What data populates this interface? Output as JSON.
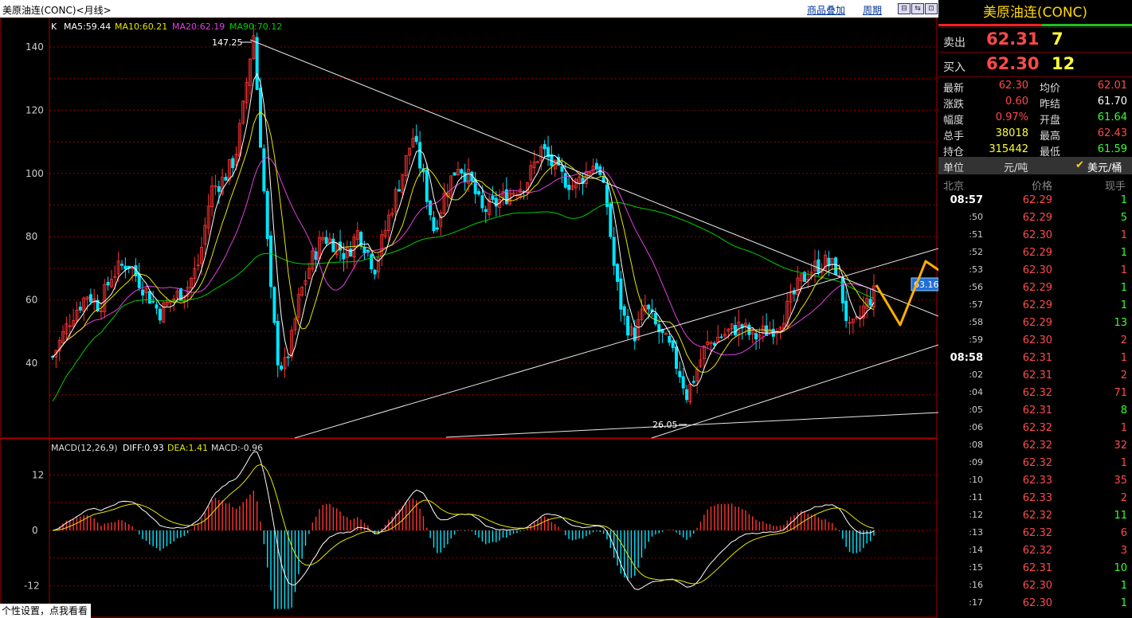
{
  "header": {
    "title": "美原油连(CONC)<月线>",
    "overlay_link": "商品叠加",
    "period_link": "周期",
    "win_buttons": [
      "⊟",
      "⇆",
      "⊡"
    ]
  },
  "indicators": {
    "main_type": "K",
    "ma5": "MA5:59.44",
    "ma10": "MA10:60.21",
    "ma20": "MA20:62.19",
    "ma90": "MA90:70.12",
    "macd_label": "MACD(12,26,9)",
    "diff": "DIFF:0.93",
    "dea": "DEA:1.41",
    "macd": "MACD:-0.96"
  },
  "chart_data": {
    "type": "candlestick",
    "main_axis": {
      "ticks": [
        "140",
        "120",
        "100",
        "80",
        "60",
        "40"
      ],
      "range": [
        25,
        150
      ]
    },
    "macd_axis": {
      "ticks": [
        "12",
        "0",
        "-12"
      ],
      "range": [
        -18,
        18
      ]
    },
    "annotations": {
      "high_label": "147.25",
      "low_label": "26.05",
      "price_tag": "63.16"
    },
    "colors": {
      "up": "#ff3333",
      "down": "#00e5ff",
      "ma5": "#ffffff",
      "ma10": "#e6e600",
      "ma20": "#e040e0",
      "ma90": "#00cc00",
      "grid": "#8b0000",
      "trendline": "#e8e8e8",
      "arrow": "#ffb000"
    }
  },
  "hint": "个性设置，点我看看",
  "quote": {
    "name": "美原油连(CONC)",
    "sell_label": "卖出",
    "sell_price": "62.31",
    "sell_vol": "7",
    "buy_label": "买入",
    "buy_price": "62.30",
    "buy_vol": "12",
    "rows": [
      {
        "k1": "最新",
        "v1": "62.30",
        "c1": "#ff4a4a",
        "k2": "均价",
        "v2": "62.01",
        "c2": "#ff4a4a"
      },
      {
        "k1": "涨跌",
        "v1": "0.60",
        "c1": "#ff4a4a",
        "k2": "昨结",
        "v2": "61.70",
        "c2": "#ffffff"
      },
      {
        "k1": "幅度",
        "v1": "0.97%",
        "c1": "#ff4a4a",
        "k2": "开盘",
        "v2": "61.64",
        "c2": "#33ff33"
      },
      {
        "k1": "总手",
        "v1": "38018",
        "c1": "#ffff33",
        "k2": "最高",
        "v2": "62.43",
        "c2": "#ff4a4a"
      },
      {
        "k1": "持仓",
        "v1": "315442",
        "c1": "#ffff33",
        "k2": "最低",
        "v2": "61.59",
        "c2": "#33ff33"
      }
    ],
    "unit_label": "单位",
    "unit_a": "元/吨",
    "unit_b": "美元/桶",
    "table_head": {
      "time": "北京",
      "price": "价格",
      "vol": "现手"
    },
    "ticks": [
      {
        "t": "08:57",
        "p": "62.29",
        "v": "1",
        "vc": "#33ff33"
      },
      {
        "t": ":50",
        "p": "62.29",
        "v": "5",
        "vc": "#33ff33"
      },
      {
        "t": ":51",
        "p": "62.30",
        "v": "1",
        "vc": "#ff4a4a"
      },
      {
        "t": ":52",
        "p": "62.29",
        "v": "1",
        "vc": "#33ff33"
      },
      {
        "t": ":53",
        "p": "62.30",
        "v": "1",
        "vc": "#ff4a4a"
      },
      {
        "t": ":56",
        "p": "62.29",
        "v": "1",
        "vc": "#33ff33"
      },
      {
        "t": ":57",
        "p": "62.29",
        "v": "1",
        "vc": "#33ff33"
      },
      {
        "t": ":58",
        "p": "62.29",
        "v": "13",
        "vc": "#33ff33"
      },
      {
        "t": ":59",
        "p": "62.30",
        "v": "2",
        "vc": "#ff4a4a"
      },
      {
        "t": "08:58",
        "p": "62.31",
        "v": "1",
        "vc": "#ff4a4a"
      },
      {
        "t": ":02",
        "p": "62.31",
        "v": "2",
        "vc": "#ff4a4a"
      },
      {
        "t": ":04",
        "p": "62.32",
        "v": "71",
        "vc": "#ff4a4a"
      },
      {
        "t": ":05",
        "p": "62.31",
        "v": "8",
        "vc": "#33ff33"
      },
      {
        "t": ":06",
        "p": "62.32",
        "v": "1",
        "vc": "#ff4a4a"
      },
      {
        "t": ":08",
        "p": "62.32",
        "v": "32",
        "vc": "#ff4a4a"
      },
      {
        "t": ":09",
        "p": "62.32",
        "v": "1",
        "vc": "#ff4a4a"
      },
      {
        "t": ":10",
        "p": "62.33",
        "v": "35",
        "vc": "#ff4a4a"
      },
      {
        "t": ":11",
        "p": "62.33",
        "v": "2",
        "vc": "#ff4a4a"
      },
      {
        "t": ":12",
        "p": "62.32",
        "v": "11",
        "vc": "#33ff33"
      },
      {
        "t": ":13",
        "p": "62.32",
        "v": "6",
        "vc": "#ff4a4a"
      },
      {
        "t": ":14",
        "p": "62.32",
        "v": "3",
        "vc": "#ff4a4a"
      },
      {
        "t": ":15",
        "p": "62.31",
        "v": "10",
        "vc": "#33ff33"
      },
      {
        "t": ":16",
        "p": "62.30",
        "v": "1",
        "vc": "#33ff33"
      },
      {
        "t": ":17",
        "p": "62.30",
        "v": "1",
        "vc": "#33ff33"
      }
    ]
  }
}
